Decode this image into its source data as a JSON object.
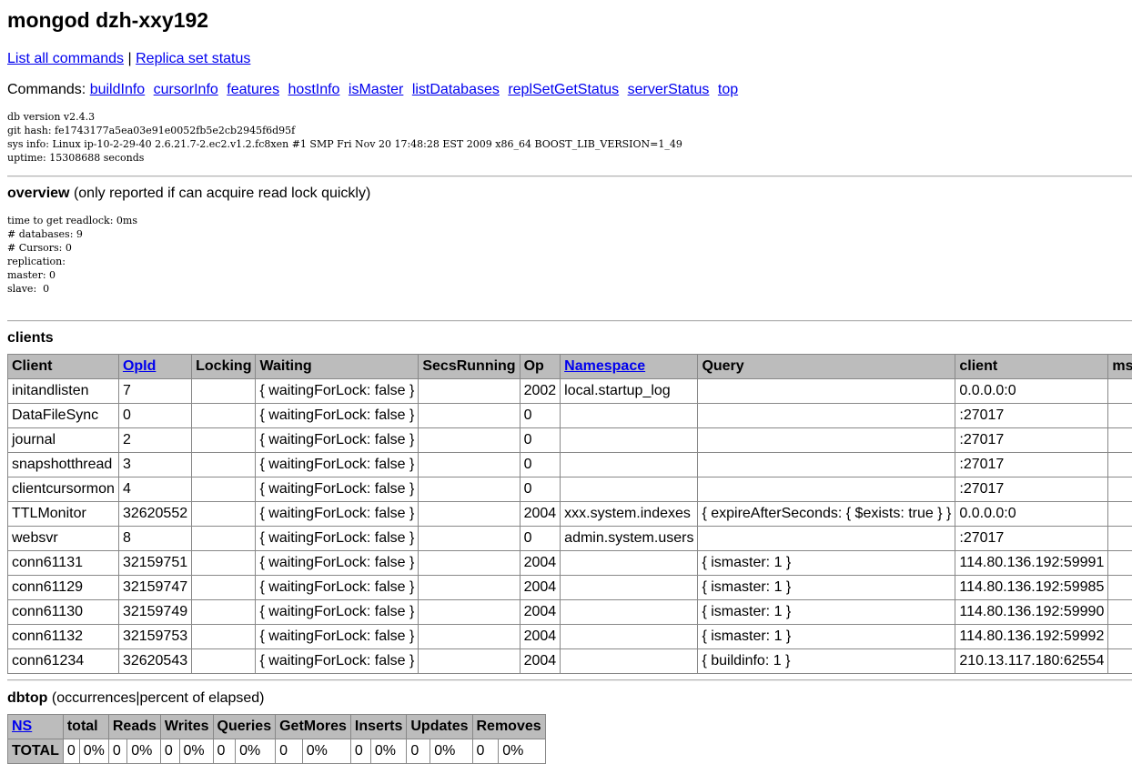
{
  "title": "mongod dzh-xxy192",
  "links": {
    "list_all": "List all commands",
    "sep": "|",
    "replica": "Replica set status"
  },
  "commands": {
    "label": "Commands:",
    "items": [
      "buildInfo",
      "cursorInfo",
      "features",
      "hostInfo",
      "isMaster",
      "listDatabases",
      "replSetGetStatus",
      "serverStatus",
      "top"
    ]
  },
  "sysinfo": "db version v2.4.3\ngit hash: fe1743177a5ea03e91e0052fb5e2cb2945f6d95f\nsys info: Linux ip-10-2-29-40 2.6.21.7-2.ec2.v1.2.fc8xen #1 SMP Fri Nov 20 17:48:28 EST 2009 x86_64 BOOST_LIB_VERSION=1_49\nuptime: 15308688 seconds",
  "overview": {
    "title": "overview",
    "note": "(only reported if can acquire read lock quickly)",
    "text": "time to get readlock: 0ms\n# databases: 9\n# Cursors: 0\nreplication:\nmaster: 0\nslave:  0"
  },
  "clients": {
    "title": "clients",
    "headers": [
      "Client",
      "OpId",
      "Locking",
      "Waiting",
      "SecsRunning",
      "Op",
      "Namespace",
      "Query",
      "client",
      "ms"
    ],
    "rows": [
      [
        "initandlisten",
        "7",
        "",
        "{ waitingForLock: false }",
        "",
        "2002",
        "local.startup_log",
        "",
        "0.0.0.0:0",
        ""
      ],
      [
        "DataFileSync",
        "0",
        "",
        "{ waitingForLock: false }",
        "",
        "0",
        "",
        "",
        ":27017",
        ""
      ],
      [
        "journal",
        "2",
        "",
        "{ waitingForLock: false }",
        "",
        "0",
        "",
        "",
        ":27017",
        ""
      ],
      [
        "snapshotthread",
        "3",
        "",
        "{ waitingForLock: false }",
        "",
        "0",
        "",
        "",
        ":27017",
        ""
      ],
      [
        "clientcursormon",
        "4",
        "",
        "{ waitingForLock: false }",
        "",
        "0",
        "",
        "",
        ":27017",
        ""
      ],
      [
        "TTLMonitor",
        "32620552",
        "",
        "{ waitingForLock: false }",
        "",
        "2004",
        "xxx.system.indexes",
        "{ expireAfterSeconds: { $exists: true } }",
        "0.0.0.0:0",
        ""
      ],
      [
        "websvr",
        "8",
        "",
        "{ waitingForLock: false }",
        "",
        "0",
        "admin.system.users",
        "",
        ":27017",
        ""
      ],
      [
        "conn61131",
        "32159751",
        "",
        "{ waitingForLock: false }",
        "",
        "2004",
        "",
        "{ ismaster: 1 }",
        "114.80.136.192:59991",
        ""
      ],
      [
        "conn61129",
        "32159747",
        "",
        "{ waitingForLock: false }",
        "",
        "2004",
        "",
        "{ ismaster: 1 }",
        "114.80.136.192:59985",
        ""
      ],
      [
        "conn61130",
        "32159749",
        "",
        "{ waitingForLock: false }",
        "",
        "2004",
        "",
        "{ ismaster: 1 }",
        "114.80.136.192:59990",
        ""
      ],
      [
        "conn61132",
        "32159753",
        "",
        "{ waitingForLock: false }",
        "",
        "2004",
        "",
        "{ ismaster: 1 }",
        "114.80.136.192:59992",
        ""
      ],
      [
        "conn61234",
        "32620543",
        "",
        "{ waitingForLock: false }",
        "",
        "2004",
        "",
        "{ buildinfo: 1 }",
        "210.13.117.180:62554",
        ""
      ]
    ]
  },
  "dbtop": {
    "title": "dbtop",
    "note": "(occurrences|percent of elapsed)",
    "headers": [
      "NS",
      "total",
      "Reads",
      "Writes",
      "Queries",
      "GetMores",
      "Inserts",
      "Updates",
      "Removes"
    ],
    "rows": [
      [
        "TOTAL",
        "0",
        "0%",
        "0",
        "0%",
        "0",
        "0%",
        "0",
        "0%",
        "0",
        "0%",
        "0",
        "0%",
        "0",
        "0%",
        "0",
        "0%"
      ]
    ]
  }
}
